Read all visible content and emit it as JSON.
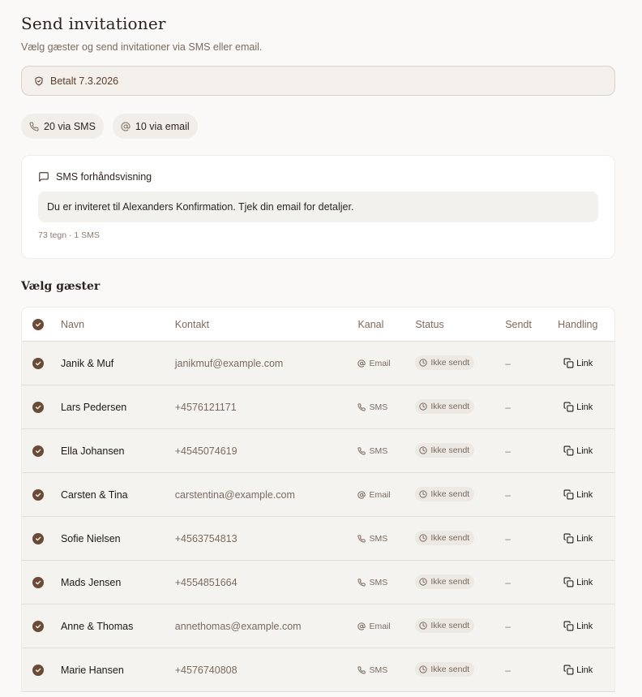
{
  "page": {
    "title": "Send invitationer",
    "subtitle": "Vælg gæster og send invitationer via SMS eller email."
  },
  "payment": {
    "icon": "shield-check-icon",
    "label": "Betalt 7.3.2026"
  },
  "counts": {
    "sms": {
      "icon": "phone-icon",
      "label": "20 via SMS"
    },
    "email": {
      "icon": "at-icon",
      "label": "10 via email"
    }
  },
  "preview": {
    "icon": "message-square-icon",
    "title": "SMS forhåndsvisning",
    "message": "Du er inviteret til Alexanders Konfirmation. Tjek din email for detaljer.",
    "meta": "73 tegn · 1 SMS"
  },
  "guests_section": {
    "title": "Vælg gæster",
    "columns": {
      "name": "Navn",
      "contact": "Kontakt",
      "channel": "Kanal",
      "status": "Status",
      "sent": "Sendt",
      "action": "Handling"
    },
    "rows": [
      {
        "name": "Janik & Muf",
        "contact": "janikmuf@example.com",
        "channel": "Email",
        "status": "Ikke sendt",
        "sent": "–",
        "action": "Link"
      },
      {
        "name": "Lars Pedersen",
        "contact": "+4576121171",
        "channel": "SMS",
        "status": "Ikke sendt",
        "sent": "–",
        "action": "Link"
      },
      {
        "name": "Ella Johansen",
        "contact": "+4545074619",
        "channel": "SMS",
        "status": "Ikke sendt",
        "sent": "–",
        "action": "Link"
      },
      {
        "name": "Carsten & Tina",
        "contact": "carstentina@example.com",
        "channel": "Email",
        "status": "Ikke sendt",
        "sent": "–",
        "action": "Link"
      },
      {
        "name": "Sofie Nielsen",
        "contact": "+4563754813",
        "channel": "SMS",
        "status": "Ikke sendt",
        "sent": "–",
        "action": "Link"
      },
      {
        "name": "Mads Jensen",
        "contact": "+4554851664",
        "channel": "SMS",
        "status": "Ikke sendt",
        "sent": "–",
        "action": "Link"
      },
      {
        "name": "Anne & Thomas",
        "contact": "annethomas@example.com",
        "channel": "Email",
        "status": "Ikke sendt",
        "sent": "–",
        "action": "Link"
      },
      {
        "name": "Marie Hansen",
        "contact": "+4576740808",
        "channel": "SMS",
        "status": "Ikke sendt",
        "sent": "–",
        "action": "Link"
      }
    ]
  },
  "colors": {
    "accent": "#6b4a36",
    "background": "#faf9f7",
    "row_background": "#f5f3f0",
    "paid_background": "#f3efeb"
  }
}
